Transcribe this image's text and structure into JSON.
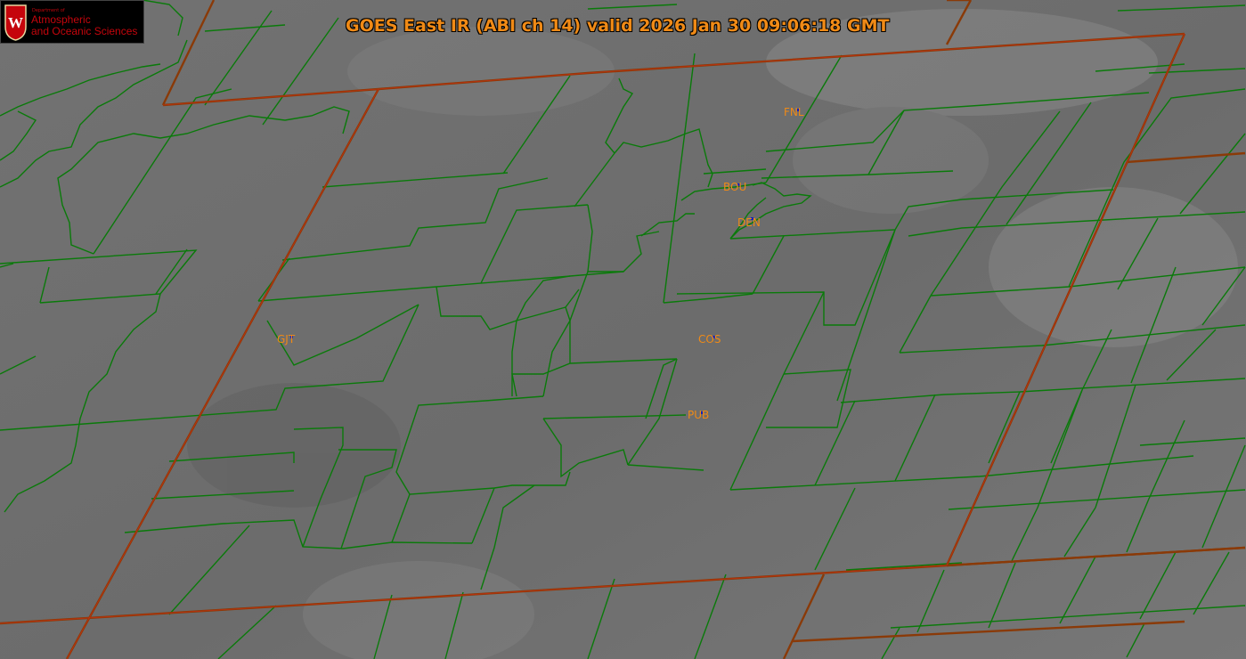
{
  "title": "GOES East IR (ABI ch 14) valid 2026 Jan 30 09:06:18 GMT",
  "logo": {
    "small_text": "Department of",
    "line1": "Atmospheric",
    "line2": "and Oceanic Sciences",
    "crest_letter": "W"
  },
  "stations": [
    {
      "code": "FNL"
    },
    {
      "code": "BOU"
    },
    {
      "code": "DEN"
    },
    {
      "code": "GJT"
    },
    {
      "code": "COS"
    },
    {
      "code": "PUB"
    }
  ],
  "colors": {
    "county_lines": "#0a7a0a",
    "state_lines": "#8a3a08",
    "station_labels": "#f08a16",
    "station_markers": "#1020c0",
    "logo_red": "#c5050c"
  }
}
